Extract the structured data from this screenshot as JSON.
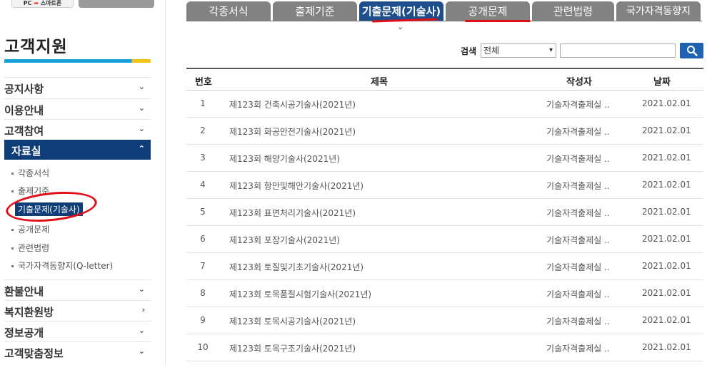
{
  "top_buttons": {
    "pc_label": "PC",
    "arrow": "➡",
    "smart_label": "스마트폰"
  },
  "sidebar": {
    "title": "고객지원",
    "nav": [
      {
        "label": "공지사항",
        "chevron": "⌄"
      },
      {
        "label": "이용안내",
        "chevron": "⌄"
      },
      {
        "label": "고객참여",
        "chevron": "⌄"
      }
    ],
    "active": {
      "label": "자료실",
      "chevron": "⌃"
    },
    "sub_items": [
      "각종서식",
      "출제기준",
      "기출문제(기술사)",
      "공개문제",
      "관련법령",
      "국가자격동향지(Q-letter)"
    ],
    "nav_bottom": [
      {
        "label": "환불안내",
        "chevron": "⌄"
      },
      {
        "label": "복지환원방",
        "chevron": "›"
      },
      {
        "label": "정보공개",
        "chevron": "⌄"
      },
      {
        "label": "고객맞춤정보",
        "chevron": "⌄"
      }
    ]
  },
  "tabs": [
    "각종서식",
    "출제기준",
    "기출문제(기술사)",
    "공개문제",
    "관련법령",
    "국가자격동향지"
  ],
  "active_tab_index": 2,
  "search": {
    "label": "검색",
    "select_value": "전체",
    "input_value": ""
  },
  "table": {
    "headers": [
      "번호",
      "제목",
      "작성자",
      "날짜"
    ],
    "rows": [
      {
        "no": "1",
        "title": "제123회 건축시공기술사(2021년)",
        "author": "기술자격출제실 ..",
        "date": "2021.02.01"
      },
      {
        "no": "2",
        "title": "제123회 화공안전기술사(2021년)",
        "author": "기술자격출제실 ..",
        "date": "2021.02.01"
      },
      {
        "no": "3",
        "title": "제123회 해양기술사(2021년)",
        "author": "기술자격출제실 ..",
        "date": "2021.02.01"
      },
      {
        "no": "4",
        "title": "제123회 항만및해안기술사(2021년)",
        "author": "기술자격출제실 ..",
        "date": "2021.02.01"
      },
      {
        "no": "5",
        "title": "제123회 표면처리기술사(2021년)",
        "author": "기술자격출제실 ..",
        "date": "2021.02.01"
      },
      {
        "no": "6",
        "title": "제123회 포장기술사(2021년)",
        "author": "기술자격출제실 ..",
        "date": "2021.02.01"
      },
      {
        "no": "7",
        "title": "제123회 토질및기초기술사(2021년)",
        "author": "기술자격출제실 ..",
        "date": "2021.02.01"
      },
      {
        "no": "8",
        "title": "제123회 토목품질시험기술사(2021년)",
        "author": "기술자격출제실 ..",
        "date": "2021.02.01"
      },
      {
        "no": "9",
        "title": "제123회 토목시공기술사(2021년)",
        "author": "기술자격출제실 ..",
        "date": "2021.02.01"
      },
      {
        "no": "10",
        "title": "제123회 토목구조기술사(2021년)",
        "author": "기술자격출제실 ..",
        "date": "2021.02.01"
      }
    ]
  },
  "colors": {
    "nav_active": "#0f3d78",
    "tab_active": "#1e4f8c",
    "tab_inactive": "#828282",
    "annotation_red": "#e0101a",
    "search_button": "#1e63b0"
  }
}
